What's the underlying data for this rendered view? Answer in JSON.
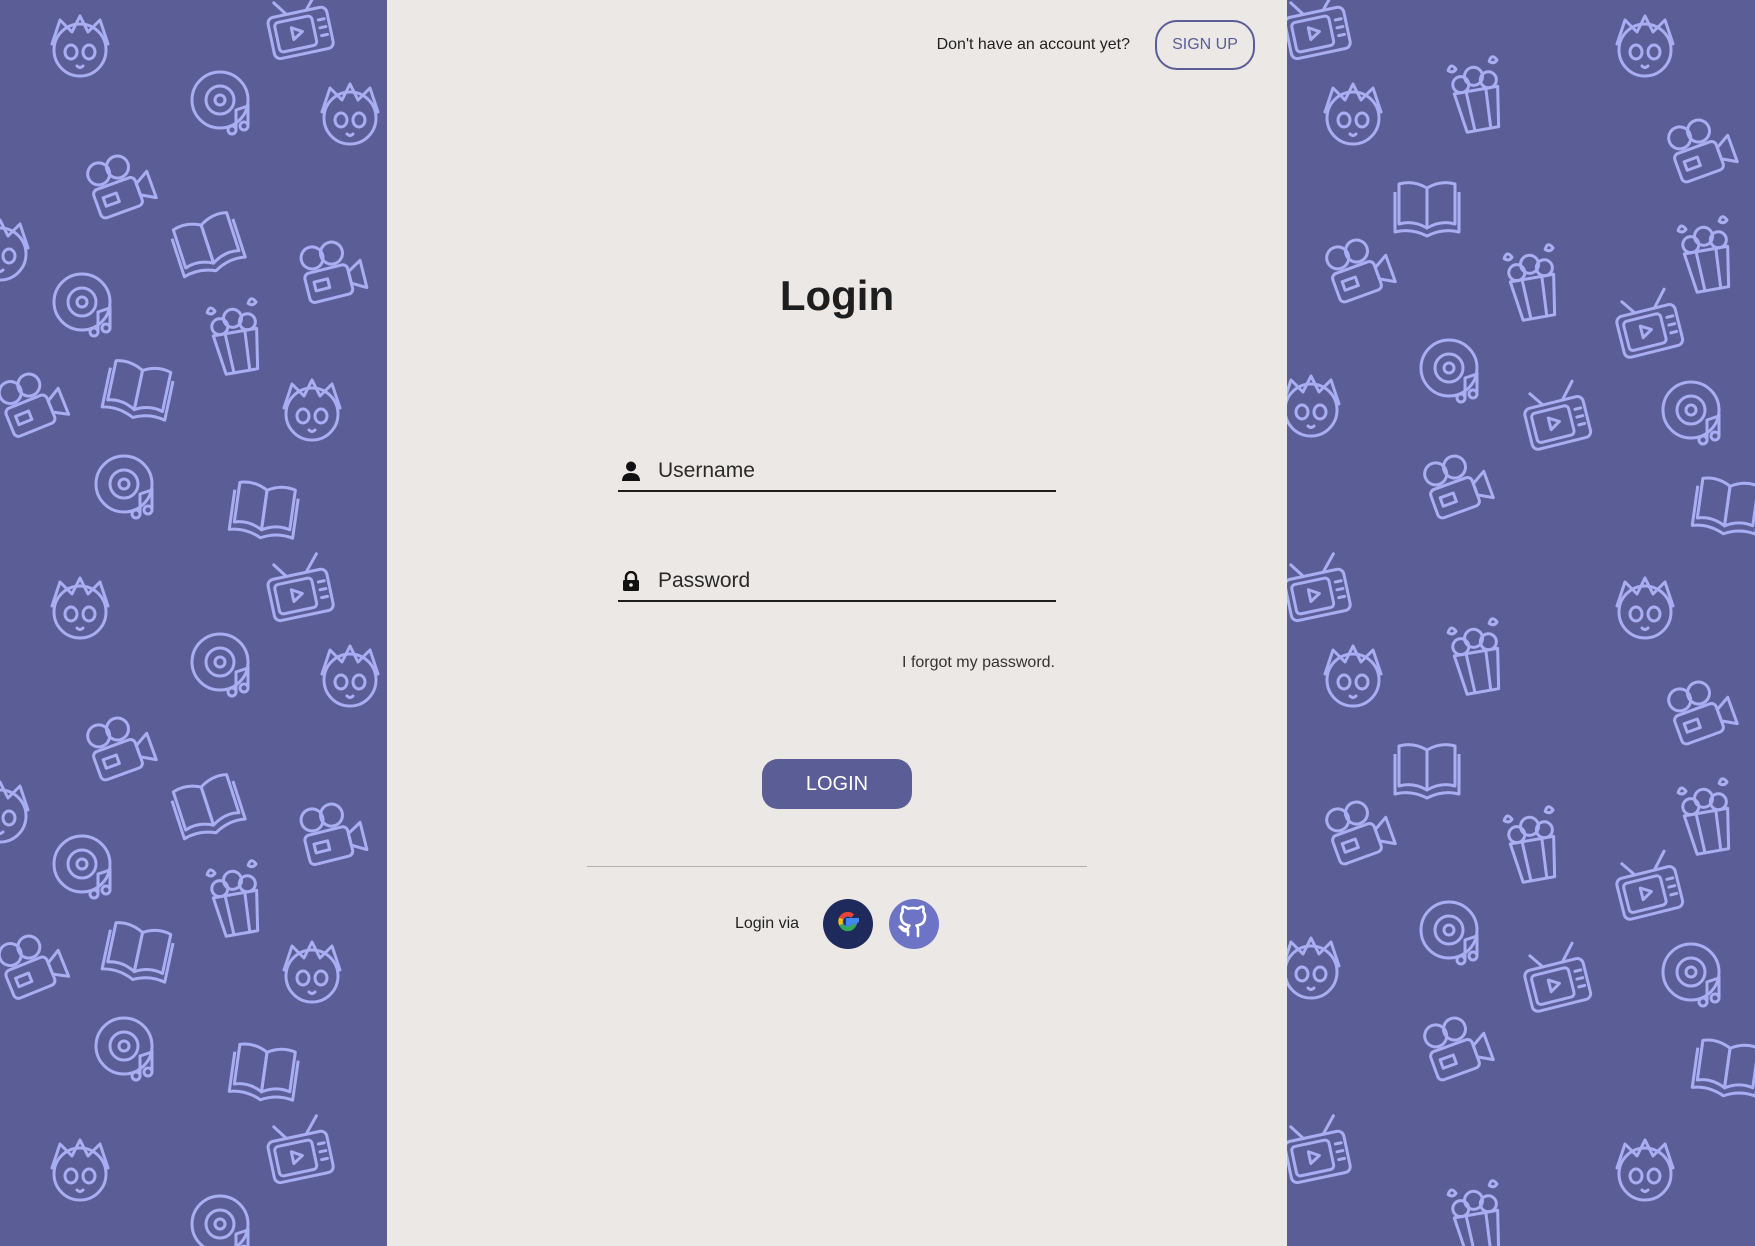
{
  "header": {
    "question": "Don't have an account yet?",
    "signup_label": "SIGN UP"
  },
  "form": {
    "title": "Login",
    "username_placeholder": "Username",
    "password_placeholder": "Password",
    "forgot_label": "I forgot my password.",
    "login_label": "LOGIN"
  },
  "social": {
    "label": "Login via",
    "providers": [
      {
        "name": "google",
        "icon": "google-icon"
      },
      {
        "name": "github",
        "icon": "github-icon"
      }
    ]
  },
  "icons": {
    "username": "user-icon",
    "password": "lock-icon",
    "background_pattern": [
      "anime-face-icon",
      "vinyl-music-icon",
      "film-camera-icon",
      "popcorn-icon",
      "book-icon",
      "tv-icon"
    ]
  },
  "colors": {
    "brand": "#5b5e96",
    "panel": "#ece8e6",
    "pattern_stroke": "#a9adf2",
    "text": "#1e1e1e"
  }
}
